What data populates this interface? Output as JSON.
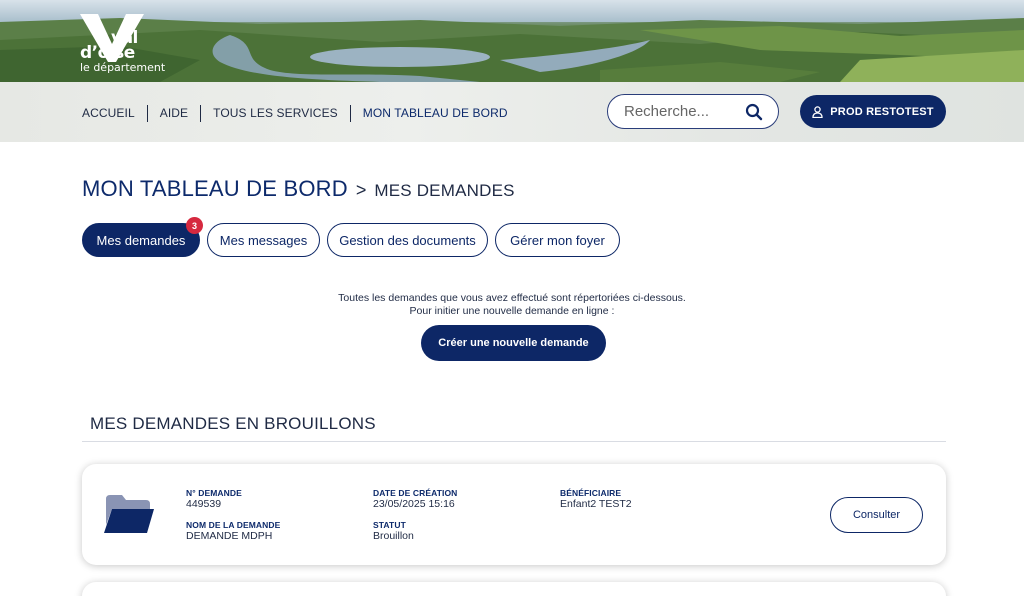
{
  "logo": {
    "line1": "val",
    "line2": "d’oise",
    "line3": "le département"
  },
  "nav": {
    "items": [
      {
        "label": "ACCUEIL"
      },
      {
        "label": "AIDE"
      },
      {
        "label": "TOUS LES SERVICES"
      },
      {
        "label": "MON TABLEAU DE BORD"
      }
    ]
  },
  "search": {
    "placeholder": "Recherche...",
    "icon": "search-icon"
  },
  "user": {
    "label": "PROD RESTOTEST",
    "icon": "user-icon"
  },
  "breadcrumb": {
    "main": "MON TABLEAU DE BORD",
    "separator": ">",
    "current": "MES DEMANDES"
  },
  "tabs": [
    {
      "label": "Mes demandes",
      "active": true,
      "badge": "3"
    },
    {
      "label": "Mes messages"
    },
    {
      "label": "Gestion des documents"
    },
    {
      "label": "Gérer mon foyer"
    }
  ],
  "intro": {
    "line1": "Toutes les demandes que vous avez effectué sont répertoriées ci-dessous.",
    "line2": "Pour initier une nouvelle demande en ligne :",
    "create_label": "Créer une nouvelle demande"
  },
  "section": {
    "title": "MES DEMANDES EN BROUILLONS"
  },
  "request": {
    "icon": "folder-icon",
    "num_label": "N° DEMANDE",
    "num_value": "449539",
    "name_label": "NOM DE LA DEMANDE",
    "name_value": "DEMANDE MDPH",
    "date_label": "DATE DE CRÉATION",
    "date_value": "23/05/2025 15:16",
    "status_label": "STATUT",
    "status_value": "Brouillon",
    "beneficiary_label": "BÉNÉFICIAIRE",
    "beneficiary_value": "Enfant2 TEST2",
    "consult_label": "Consulter"
  },
  "colors": {
    "primary": "#0d2766",
    "badge": "#d6293f",
    "text": "#1f2a44"
  }
}
